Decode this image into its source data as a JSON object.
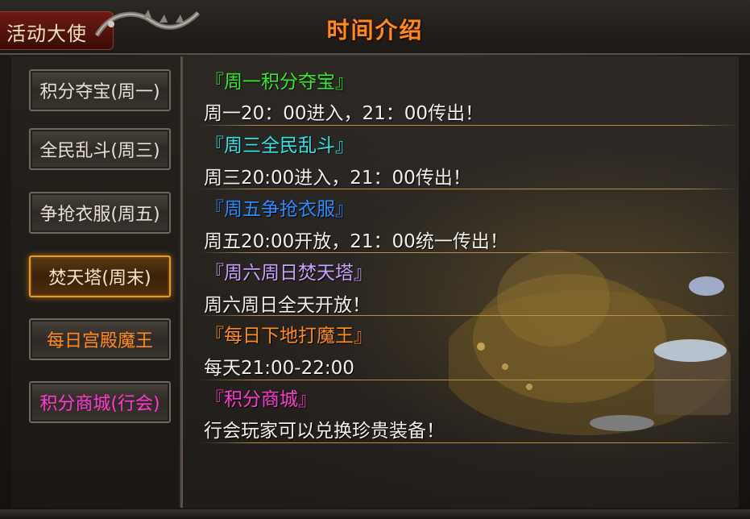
{
  "header": {
    "tag_label": "活动大使",
    "title": "时间介绍",
    "title_color": "#ff8a1a"
  },
  "tabs": [
    {
      "label": "积分夺宝(周一)",
      "color": "#e6e0d6"
    },
    {
      "label": "全民乱斗(周三)",
      "color": "#e6e0d6"
    },
    {
      "label": "争抢衣服(周五)",
      "color": "#e6e0d6"
    },
    {
      "label": "焚天塔(周末)",
      "color": "#f6e6c6",
      "selected": true
    },
    {
      "label": "每日宫殿魔王",
      "color": "#ff8c1a"
    },
    {
      "label": "积分商城(行会)",
      "color": "#ff3ad2"
    }
  ],
  "events": [
    {
      "title": "『周一积分夺宝』",
      "title_color": "#36e82a",
      "desc": "周一20：00进入，21：00传出！"
    },
    {
      "title": "『周三全民乱斗』",
      "title_color": "#2fe6e6",
      "desc": "周三20:00进入，21：00传出！"
    },
    {
      "title": "『周五争抢衣服』",
      "title_color": "#2a8cff",
      "desc": "周五20:00开放，21：00统一传出！"
    },
    {
      "title": "『周六周日焚天塔』",
      "title_color": "#c8a2ff",
      "desc": "周六周日全天开放！"
    },
    {
      "title": "『每日下地打魔王』",
      "title_color": "#ff8c1a",
      "desc": "每天21:00-22:00"
    },
    {
      "title": "『积分商城』",
      "title_color": "#ff3ad2",
      "desc": "行会玩家可以兑换珍贵装备！"
    }
  ]
}
